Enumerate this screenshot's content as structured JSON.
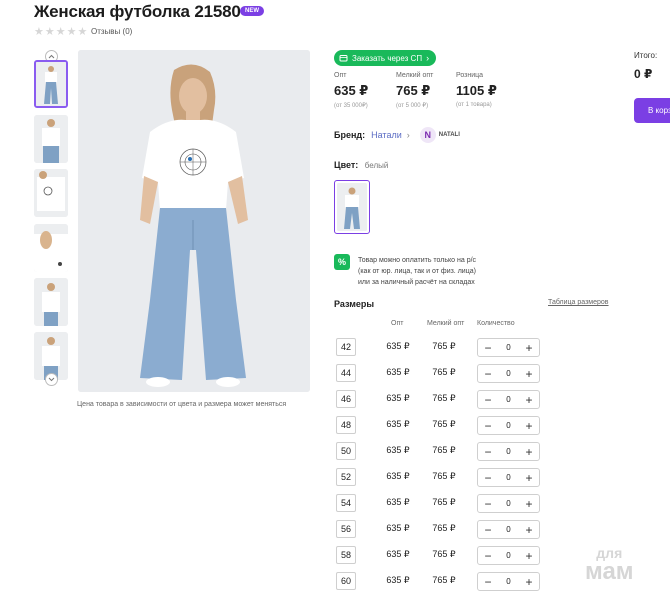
{
  "product": {
    "title": "Женская футболка 21580",
    "badge": "NEW",
    "reviews": "Отзывы (0)",
    "rating_stars": 0,
    "photo_note": "Цена товара в зависимости от цвета и размера может меняться"
  },
  "order_sp": {
    "label": "Заказать через СП"
  },
  "prices": [
    {
      "label": "Опт",
      "value": "635 ₽",
      "sub": "(от 35 000₽)"
    },
    {
      "label": "Мелкий опт",
      "value": "765 ₽",
      "sub": "(от 5 000 ₽)"
    },
    {
      "label": "Розница",
      "value": "1105 ₽",
      "sub": "(от 1 товара)"
    }
  ],
  "total": {
    "label": "Итого:",
    "value": "0 ₽",
    "cart_button": "В корз"
  },
  "brand": {
    "label": "Бренд:",
    "name": "Натали",
    "logo_letter": "N",
    "logo_text": "NATALI"
  },
  "color": {
    "label": "Цвет:",
    "value": "белый"
  },
  "payment": {
    "icon": "%",
    "lines": [
      "Товар можно оплатить только на р/с",
      "(как от юр. лица, так и от физ. лица)",
      "или за наличный расчёт на складах"
    ]
  },
  "sizes": {
    "title": "Размеры",
    "table_link": "Таблица размеров",
    "headers": {
      "opt": "Опт",
      "melkiy": "Мелкий опт",
      "qty": "Количество"
    },
    "rows": [
      {
        "size": "42",
        "opt": "635 ₽",
        "melkiy": "765 ₽",
        "qty": "0"
      },
      {
        "size": "44",
        "opt": "635 ₽",
        "melkiy": "765 ₽",
        "qty": "0"
      },
      {
        "size": "46",
        "opt": "635 ₽",
        "melkiy": "765 ₽",
        "qty": "0"
      },
      {
        "size": "48",
        "opt": "635 ₽",
        "melkiy": "765 ₽",
        "qty": "0"
      },
      {
        "size": "50",
        "opt": "635 ₽",
        "melkiy": "765 ₽",
        "qty": "0"
      },
      {
        "size": "52",
        "opt": "635 ₽",
        "melkiy": "765 ₽",
        "qty": "0"
      },
      {
        "size": "54",
        "opt": "635 ₽",
        "melkiy": "765 ₽",
        "qty": "0"
      },
      {
        "size": "56",
        "opt": "635 ₽",
        "melkiy": "765 ₽",
        "qty": "0"
      },
      {
        "size": "58",
        "opt": "635 ₽",
        "melkiy": "765 ₽",
        "qty": "0"
      },
      {
        "size": "60",
        "opt": "635 ₽",
        "melkiy": "765 ₽",
        "qty": "0"
      }
    ]
  },
  "watermark": {
    "line1": "для",
    "line2": "мам"
  },
  "colors": {
    "accent": "#7b3fe4",
    "green": "#19b95a",
    "link": "#5b6cc4"
  }
}
